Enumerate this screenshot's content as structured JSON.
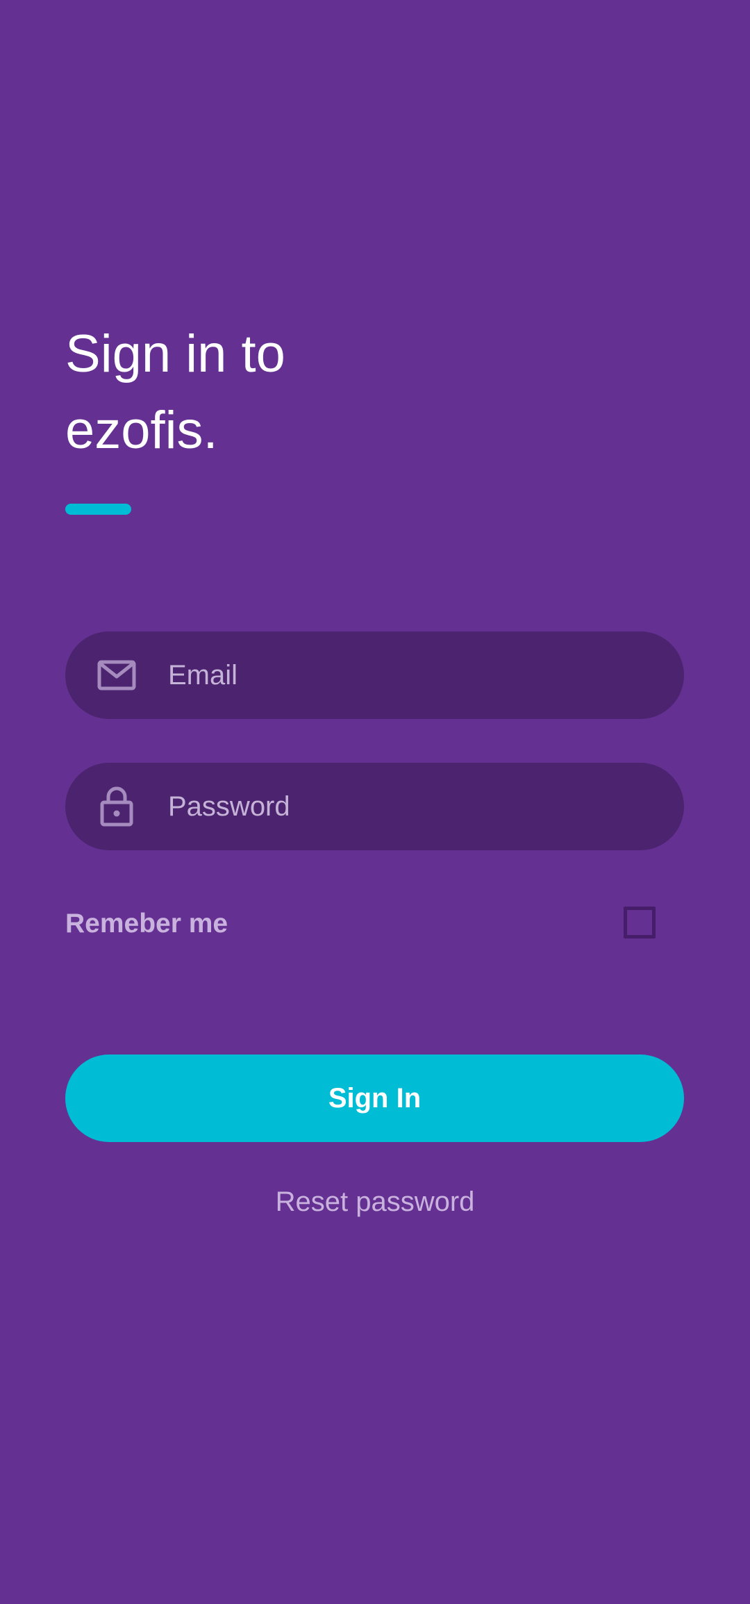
{
  "header": {
    "title_line1": "Sign in to",
    "title_line2": "ezofis."
  },
  "form": {
    "email": {
      "placeholder": "Email",
      "value": "",
      "icon": "mail-icon"
    },
    "password": {
      "placeholder": "Password",
      "value": "",
      "icon": "lock-icon"
    },
    "remember_label": "Remeber me",
    "remember_checked": false,
    "signin_label": "Sign In",
    "reset_label": "Reset password"
  },
  "colors": {
    "background": "#643193",
    "field_background": "#4b236f",
    "accent": "#00bcd4",
    "muted_text": "#c9b2dd"
  }
}
